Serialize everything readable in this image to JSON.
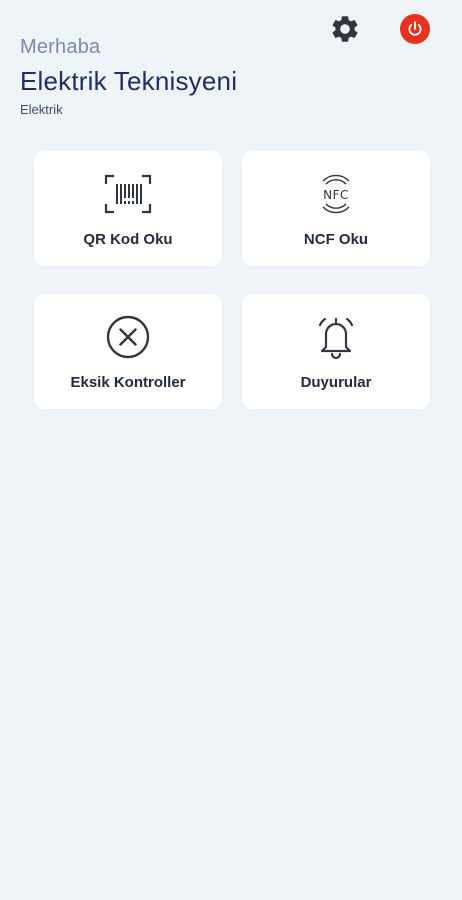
{
  "header": {
    "greeting": "Merhaba",
    "user_name": "Elektrik Teknisyeni",
    "role": "Elektrik",
    "settings_icon": "gear-icon",
    "power_icon": "power-icon",
    "power_color": "#e8311f"
  },
  "menu": {
    "qr": {
      "label": "QR Kod Oku",
      "icon": "barcode-scan-icon"
    },
    "nfc": {
      "label": "NCF Oku",
      "icon": "nfc-icon",
      "icon_text": "NFC"
    },
    "missing": {
      "label": "Eksik Kontroller",
      "icon": "x-circle-icon"
    },
    "announcements": {
      "label": "Duyurular",
      "icon": "bell-icon"
    }
  },
  "colors": {
    "background": "#eef3f7",
    "card": "#ffffff",
    "title": "#1f2f63",
    "subtitle": "#7d8aae"
  }
}
